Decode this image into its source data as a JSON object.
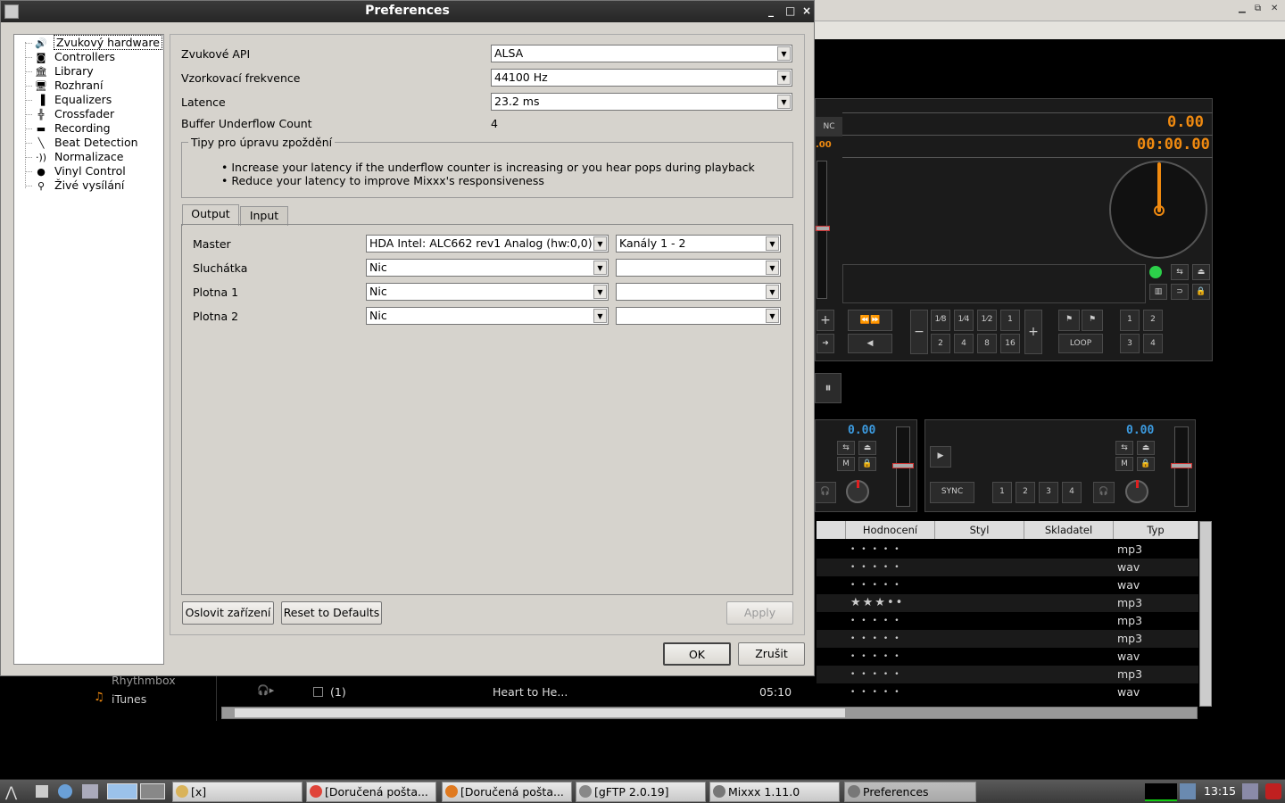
{
  "dialog": {
    "title": "Preferences",
    "window_controls": [
      "_",
      "□",
      "×"
    ]
  },
  "tree": {
    "items": [
      {
        "label": "Zvukový hardware",
        "icon": "speaker-icon",
        "glyph": "🔊",
        "selected": true
      },
      {
        "label": "Controllers",
        "icon": "controller-icon",
        "glyph": "◙"
      },
      {
        "label": "Library",
        "icon": "library-icon",
        "glyph": "🏛"
      },
      {
        "label": "Rozhraní",
        "icon": "monitor-icon",
        "glyph": "🖥"
      },
      {
        "label": "Equalizers",
        "icon": "equalizer-icon",
        "glyph": "▐"
      },
      {
        "label": "Crossfader",
        "icon": "crossfader-icon",
        "glyph": "╬"
      },
      {
        "label": "Recording",
        "icon": "recording-icon",
        "glyph": "▬"
      },
      {
        "label": "Beat Detection",
        "icon": "beat-detection-icon",
        "glyph": "╲"
      },
      {
        "label": "Normalizace",
        "icon": "normalize-icon",
        "glyph": "·))"
      },
      {
        "label": "Vinyl Control",
        "icon": "vinyl-icon",
        "glyph": "●"
      },
      {
        "label": "Živé vysílání",
        "icon": "broadcast-icon",
        "glyph": "⚲"
      }
    ]
  },
  "sound": {
    "api_label": "Zvukové API",
    "api_value": "ALSA",
    "rate_label": "Vzorkovací frekvence",
    "rate_value": "44100 Hz",
    "latency_label": "Latence",
    "latency_value": "23.2 ms",
    "underflow_label": "Buffer Underflow Count",
    "underflow_value": "4",
    "tips_legend": "Tipy pro úpravu zpoždění",
    "tips": [
      "Increase your latency if the underflow counter is increasing or you hear pops during playback",
      "Reduce your latency to improve Mixxx's responsiveness"
    ]
  },
  "tabs": [
    "Output",
    "Input"
  ],
  "outputs": [
    {
      "label": "Master",
      "device": "HDA Intel: ALC662 rev1 Analog (hw:0,0)",
      "channels": "Kanály 1 - 2"
    },
    {
      "label": "Sluchátka",
      "device": "Nic",
      "channels": ""
    },
    {
      "label": "Plotna 1",
      "device": "Nic",
      "channels": ""
    },
    {
      "label": "Plotna 2",
      "device": "Nic",
      "channels": ""
    }
  ],
  "buttons": {
    "query": "Oslovit zařízení",
    "reset": "Reset to Defaults",
    "apply": "Apply",
    "ok": "OK",
    "cancel": "Zrušit"
  },
  "mixxx": {
    "bpm": "0.00",
    "time": "00:00.00",
    "deck_small_bpm": "0.00",
    "deck2_bpm": "0.00",
    "partial_sync": "NC",
    "partial_bpm": ".00",
    "beatjump_top": [
      "1⁄8",
      "1⁄4",
      "1⁄2",
      "1"
    ],
    "beatjump_bottom": [
      "2",
      "4",
      "8",
      "16"
    ],
    "loop_label": "LOOP",
    "hotcues_top": [
      "1",
      "2"
    ],
    "hotcues_bottom": [
      "3",
      "4"
    ],
    "sync_label": "SYNC",
    "deck2_hotcues": [
      "1",
      "2",
      "3",
      "4"
    ],
    "m_label": "M",
    "library_columns": [
      "Hodnocení",
      "Styl",
      "Skladatel",
      "Typ"
    ],
    "library_types": [
      "mp3",
      "wav",
      "wav",
      "mp3",
      "mp3",
      "mp3",
      "wav",
      "mp3",
      "wav"
    ],
    "library_ratings": [
      0,
      0,
      0,
      3,
      0,
      0,
      0,
      0,
      0
    ],
    "visible_track": {
      "num": "(1)",
      "title": "Heart to He...",
      "duration": "05:10"
    },
    "sidebar_items": [
      "Rhythmbox",
      "iTunes"
    ]
  },
  "taskbar": {
    "items": [
      {
        "label": "[x]",
        "icon": "folder-icon",
        "color": "#d9b35a"
      },
      {
        "label": "[Doručená pošta...",
        "icon": "chrome-icon",
        "color": "#e0443a"
      },
      {
        "label": "[Doručená pošta...",
        "icon": "firefox-icon",
        "color": "#e07a20"
      },
      {
        "label": "[gFTP 2.0.19]",
        "icon": "gftp-icon",
        "color": "#888888"
      },
      {
        "label": "Mixxx 1.11.0",
        "icon": "mixxx-icon",
        "color": "#777777"
      },
      {
        "label": "Preferences",
        "icon": "mixxx-icon",
        "color": "#777777",
        "active": true
      }
    ],
    "clock": "13:15"
  }
}
